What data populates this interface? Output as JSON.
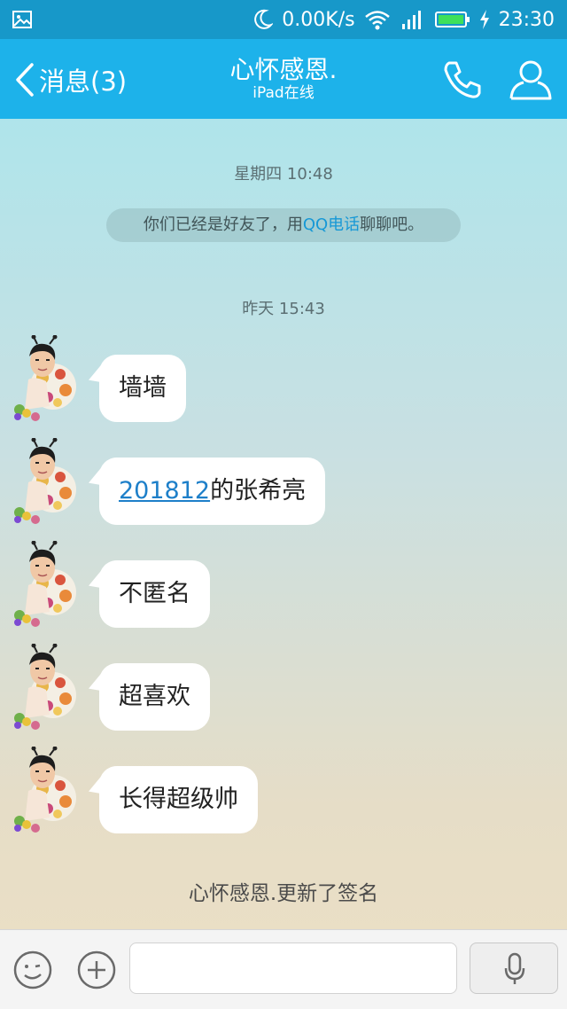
{
  "status_bar": {
    "network_speed": "0.00K/s",
    "time": "23:30",
    "icons": [
      "image-icon",
      "moon-icon",
      "wifi-icon",
      "signal-icon",
      "battery-icon",
      "charging-icon"
    ]
  },
  "header": {
    "back_label": "消息(3)",
    "title": "心怀感恩.",
    "subtitle": "iPad在线",
    "icons": [
      "back-arrow-icon",
      "phone-icon",
      "profile-icon"
    ]
  },
  "chat": {
    "timestamp_1": "星期四 10:48",
    "notice_prefix": "你们已经是好友了，用",
    "notice_link": "QQ电话",
    "notice_suffix": "聊聊吧。",
    "timestamp_2": "昨天 15:43",
    "messages": [
      {
        "text": "墙墙"
      },
      {
        "number": "201812",
        "text": "的张希亮"
      },
      {
        "text": "不匿名"
      },
      {
        "text": "超喜欢"
      },
      {
        "text": "长得超级帅"
      }
    ],
    "signature_update": "心怀感恩.更新了签名"
  },
  "input_bar": {
    "placeholder": "",
    "icons": [
      "emoji-icon",
      "plus-icon",
      "microphone-icon"
    ]
  },
  "colors": {
    "status_bar": "#1798c9",
    "header": "#1db2ea",
    "link": "#1698d6"
  }
}
